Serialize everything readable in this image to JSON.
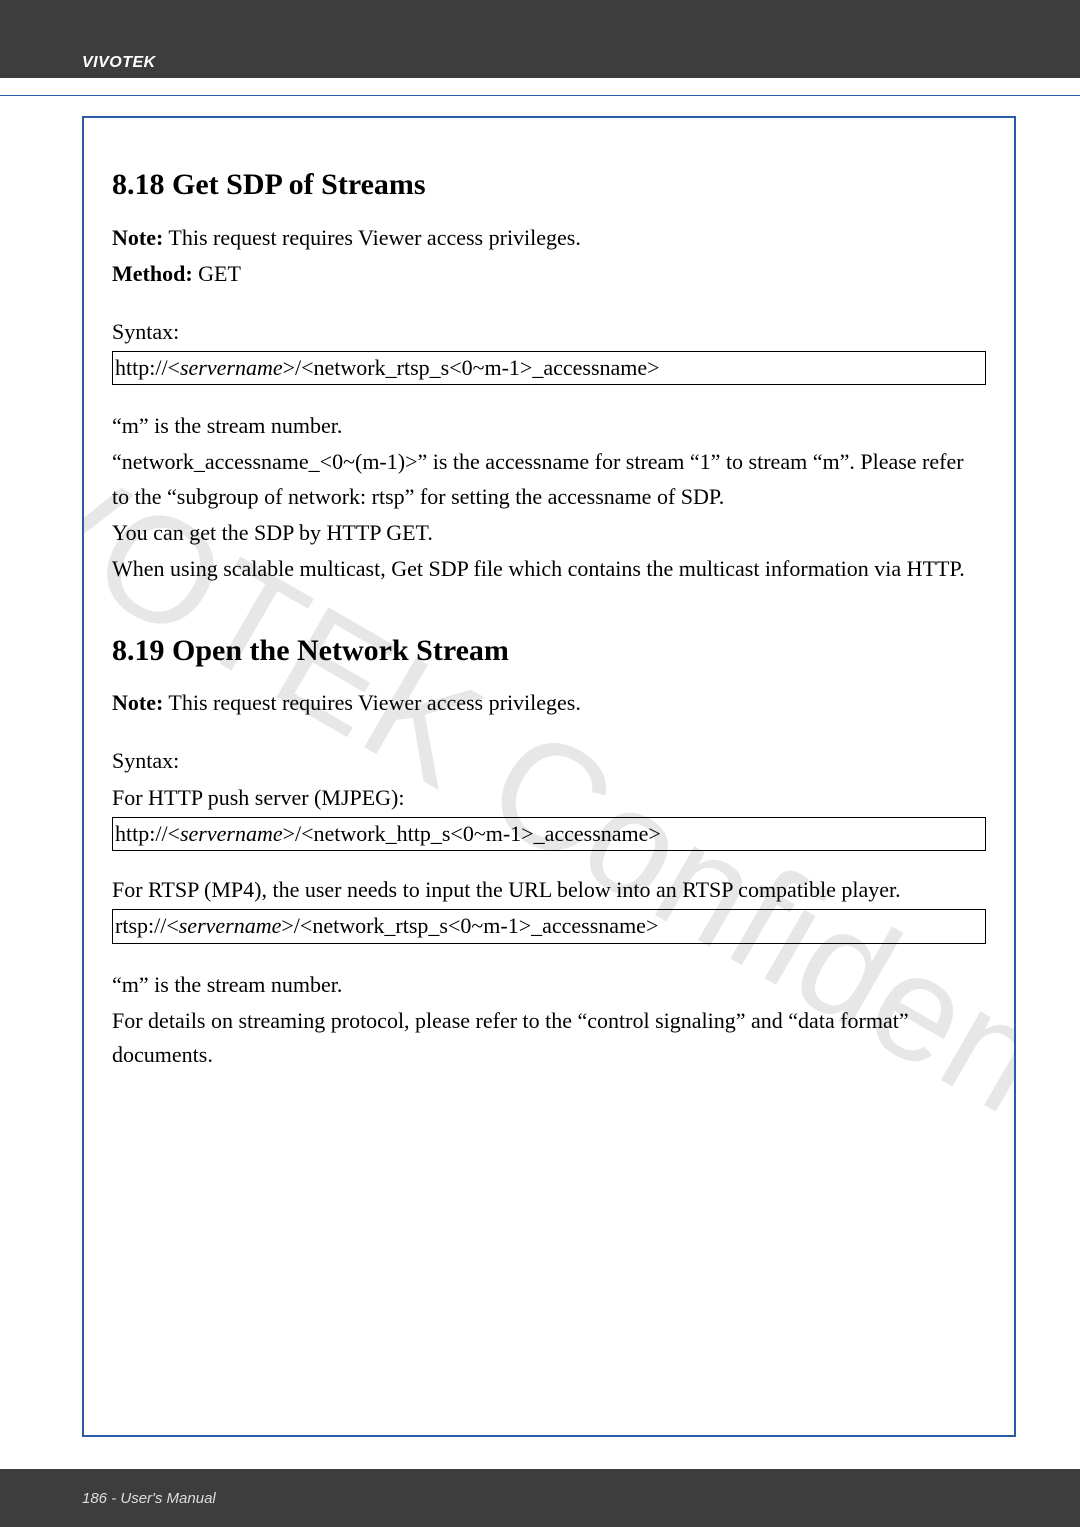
{
  "header": {
    "brand": "VIVOTEK"
  },
  "watermark": "VIVOTEK Confidential",
  "section818": {
    "heading": "8.18 Get SDP of Streams",
    "note_label": "Note:",
    "note_text": " This request requires Viewer access privileges.",
    "method_label": "Method:",
    "method_value": " GET",
    "syntax_label": "Syntax:",
    "syntax_prefix": "http://<",
    "syntax_servername": "servername",
    "syntax_suffix": ">/<network_rtsp_s<0~m-1>_accessname>",
    "para1": "“m” is the stream number.",
    "para2": "“network_accessname_<0~(m-1)>” is the accessname for stream “1” to stream “m”. Please refer to the “subgroup of network: rtsp” for setting the accessname of SDP.",
    "para3": "You can get the SDP by HTTP GET.",
    "para4": "When using scalable multicast, Get SDP file which contains the multicast information via HTTP."
  },
  "section819": {
    "heading": "8.19 Open the Network Stream",
    "note_label": "Note:",
    "note_text": " This request requires Viewer access privileges.",
    "syntax_label": "Syntax:",
    "http_intro": "For HTTP push server (MJPEG):",
    "http_prefix": "http://<",
    "http_servername": "servername",
    "http_suffix": ">/<network_http_s<0~m-1>_accessname>",
    "rtsp_intro": "For RTSP (MP4), the user needs to input the URL below into an RTSP compatible player.",
    "rtsp_prefix": "rtsp://<",
    "rtsp_servername": "servername",
    "rtsp_suffix": ">/<network_rtsp_s<0~m-1>_accessname>",
    "para1": "“m” is the stream number.",
    "para2": "For details on streaming protocol, please refer to the “control signaling” and “data format” documents."
  },
  "footer": {
    "text": "186 - User's Manual"
  }
}
